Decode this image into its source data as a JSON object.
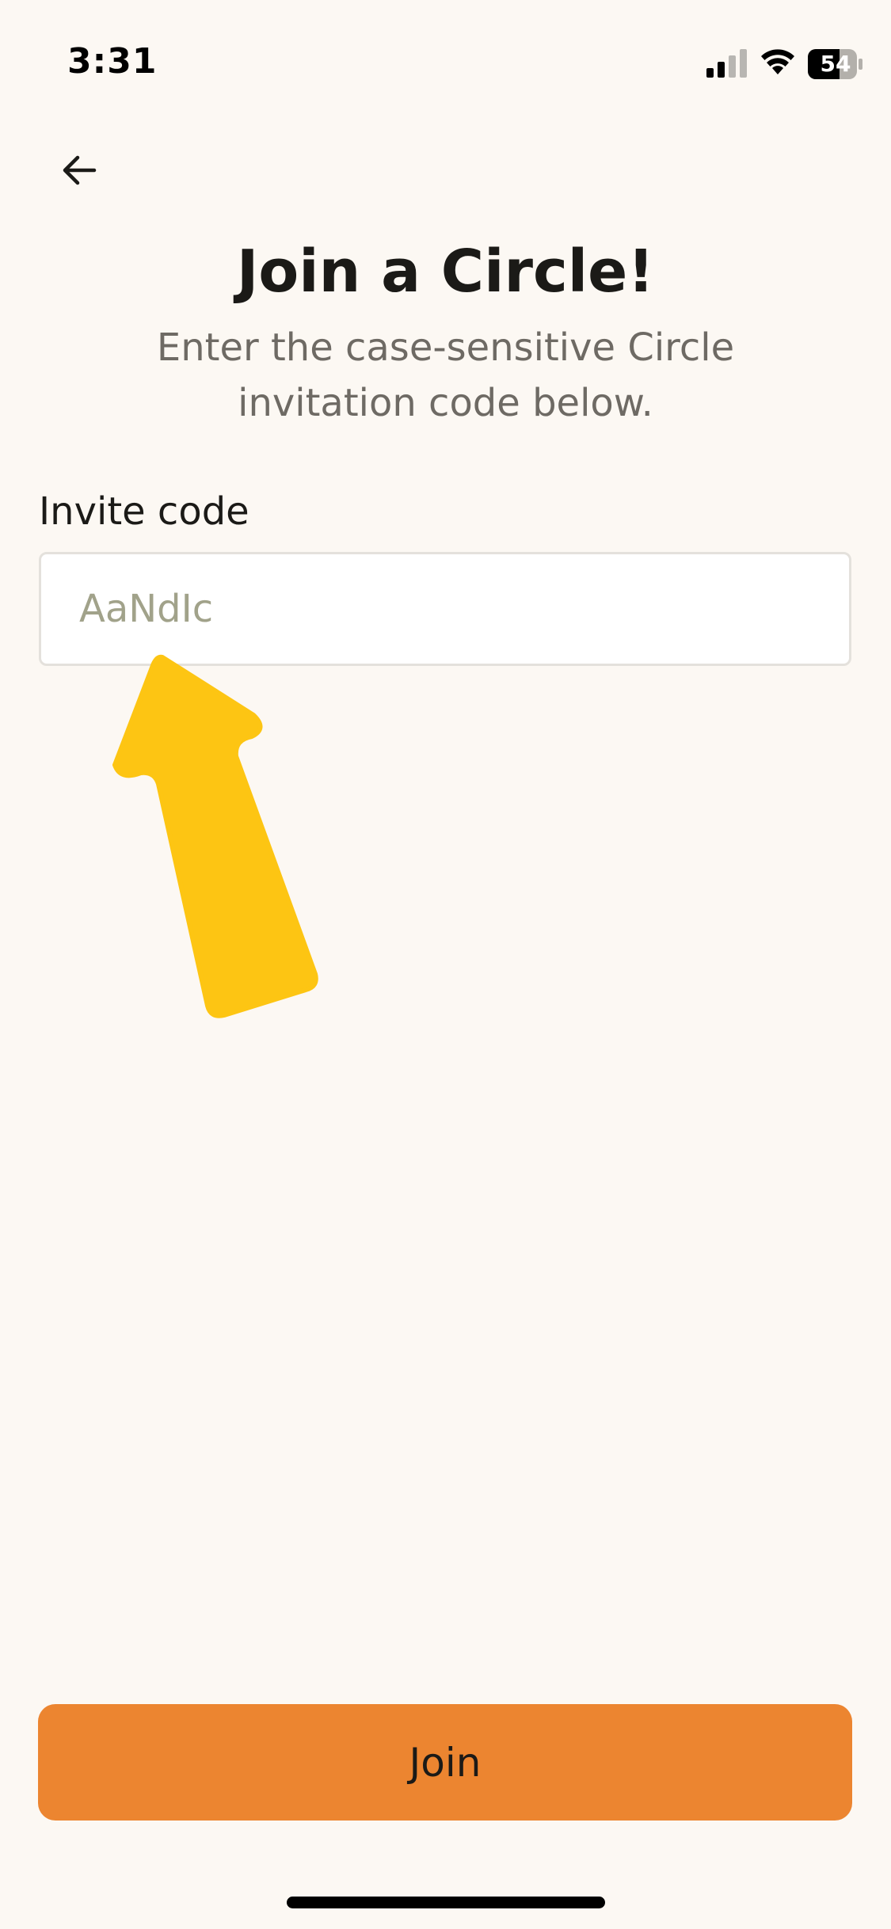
{
  "status_bar": {
    "time": "3:31",
    "battery": "54",
    "icons": [
      "signal-icon",
      "wifi-icon",
      "battery-icon"
    ]
  },
  "nav": {
    "back_icon": "arrow-left-icon"
  },
  "header": {
    "title": "Join a Circle!",
    "subtitle": "Enter the case-sensitive Circle invitation code below."
  },
  "form": {
    "label": "Invite code",
    "value": "",
    "placeholder": "AaNdIc"
  },
  "join_button": {
    "label": "Join"
  },
  "colors": {
    "background": "#FCF8F3",
    "accent": "#EC8530",
    "arrow": "#FDC513"
  }
}
